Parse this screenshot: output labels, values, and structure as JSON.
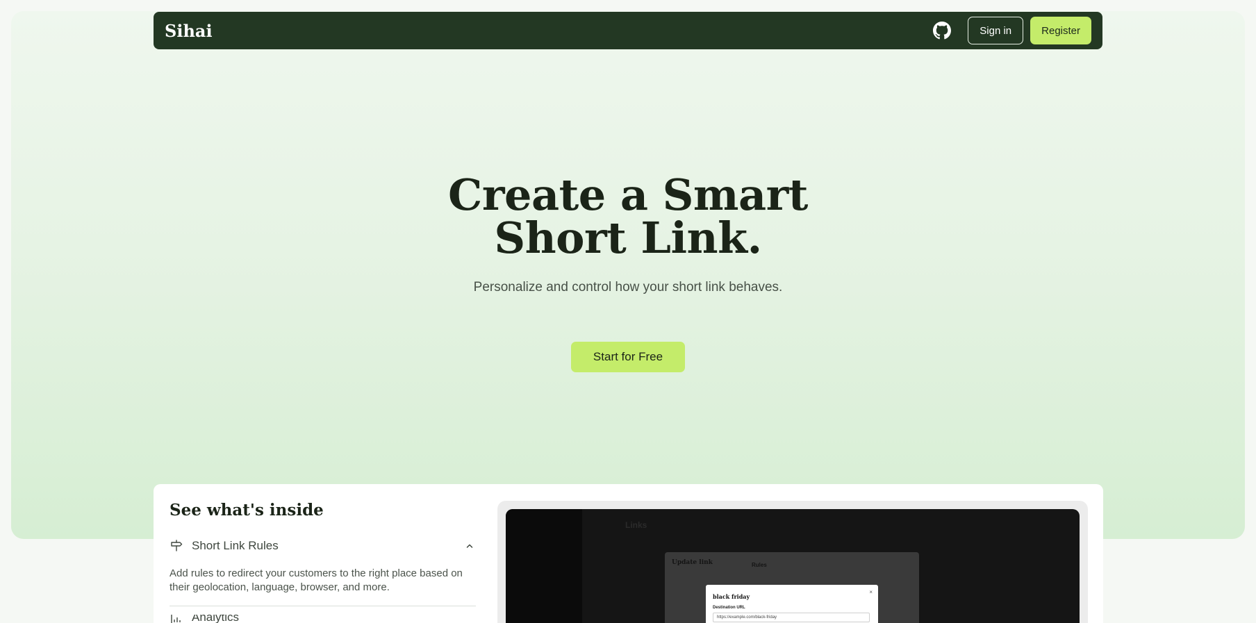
{
  "header": {
    "logo": "Sihai",
    "github_icon": "github-icon",
    "signin_label": "Sign in",
    "register_label": "Register"
  },
  "hero": {
    "title_line1": "Create a Smart",
    "title_line2": "Short Link.",
    "subtitle": "Personalize and control how your short link behaves.",
    "cta_label": "Start for Free"
  },
  "inside": {
    "title": "See what's inside",
    "items": [
      {
        "icon": "signpost-icon",
        "label": "Short Link Rules",
        "description": "Add rules to redirect your customers to the right place based on their geolocation, language, browser, and more.",
        "expanded": true
      },
      {
        "icon": "bar-chart-icon",
        "label": "Analytics",
        "expanded": false
      }
    ]
  },
  "preview": {
    "page_title": "Links",
    "modal_title": "Update link",
    "rules_label": "Rules",
    "dialog_title": "black friday",
    "dialog_close": "×",
    "dialog_field_label": "Destination URL",
    "dialog_field_value": "https://example.com/black-friday"
  },
  "colors": {
    "nav_bg": "#233823",
    "accent": "#c4ec6a",
    "hero_top": "#eff7ee",
    "hero_bottom": "#d6eed3"
  }
}
